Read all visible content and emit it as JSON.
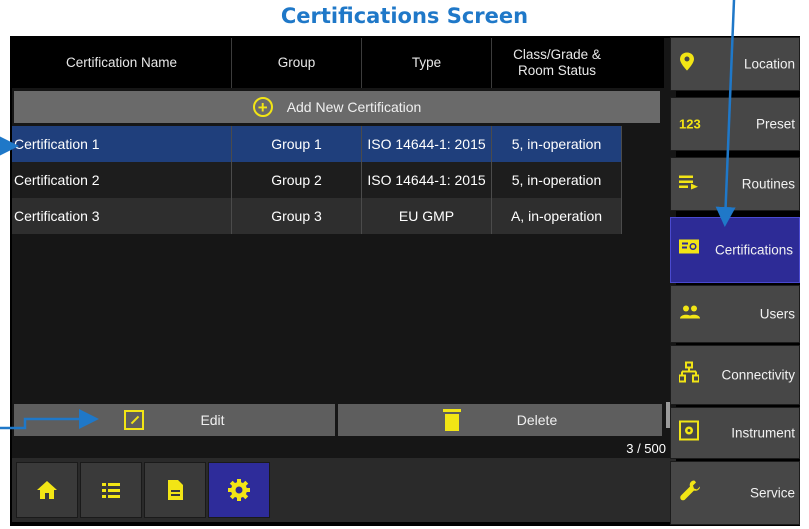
{
  "title": "Certifications Screen",
  "table": {
    "headers": [
      "Certification Name",
      "Group",
      "Type",
      "Class/Grade & Room Status"
    ],
    "add_label": "Add New Certification",
    "rows": [
      [
        "Certification 1",
        "Group 1",
        "ISO 14644-1: 2015",
        "5, in-operation"
      ],
      [
        "Certification 2",
        "Group 2",
        "ISO 14644-1: 2015",
        "5, in-operation"
      ],
      [
        "Certification 3",
        "Group 3",
        "EU GMP",
        "A, in-operation"
      ]
    ],
    "selected_row": 0
  },
  "actions": {
    "edit": "Edit",
    "delete": "Delete"
  },
  "count": "3 / 500",
  "bottom_nav": [
    {
      "icon": "home-icon",
      "active": false
    },
    {
      "icon": "list-icon",
      "active": false
    },
    {
      "icon": "document-icon",
      "active": false
    },
    {
      "icon": "gear-icon",
      "active": true
    }
  ],
  "side_nav": [
    {
      "icon": "location-pin-icon",
      "label": "Location",
      "active": false
    },
    {
      "icon": "preset-123-icon",
      "label": "Preset",
      "active": false
    },
    {
      "icon": "routines-icon",
      "label": "Routines",
      "active": false
    },
    {
      "icon": "certifications-icon",
      "label": "Certifications",
      "active": true
    },
    {
      "icon": "users-icon",
      "label": "Users",
      "active": false
    },
    {
      "icon": "connectivity-icon",
      "label": "Connectivity",
      "active": false
    },
    {
      "icon": "instrument-icon",
      "label": "Instrument",
      "active": false
    },
    {
      "icon": "wrench-icon",
      "label": "Service",
      "active": false
    }
  ],
  "colors": {
    "accent_yellow": "#f2e515",
    "selected_blue": "#1f3f7c",
    "active_nav": "#2e2c9a",
    "annotation": "#1f78c8"
  }
}
